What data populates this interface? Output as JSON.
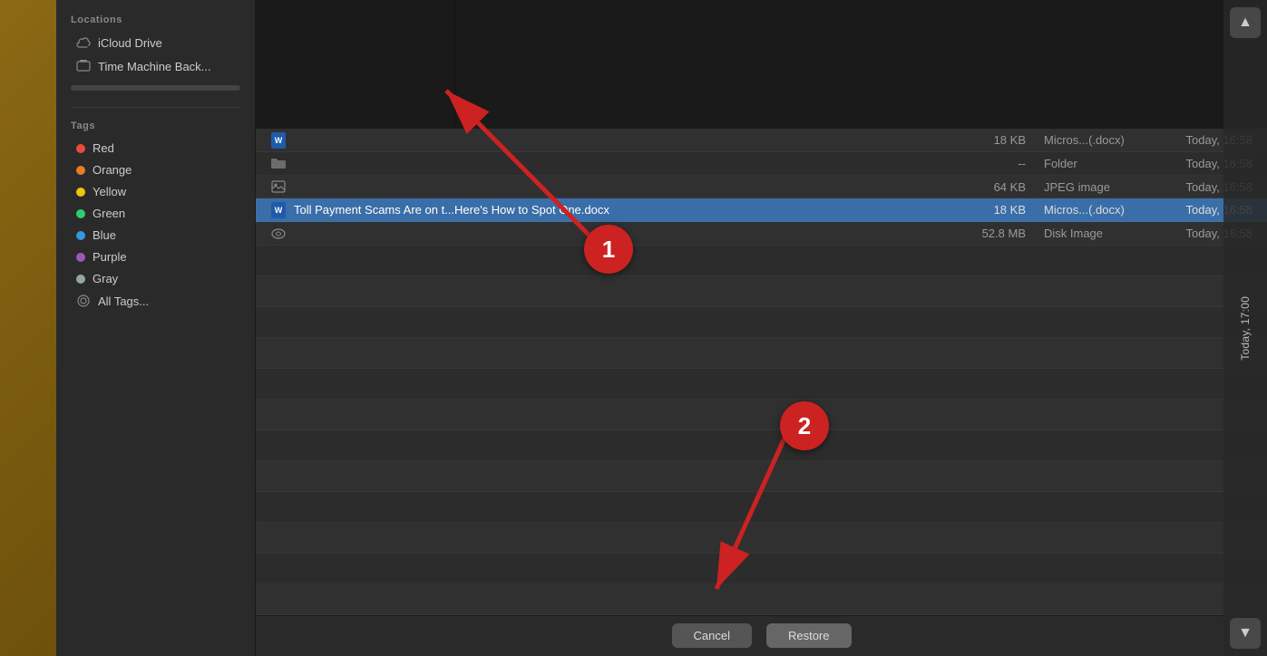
{
  "sidebar": {
    "locations_label": "Locations",
    "icloud_label": "iCloud Drive",
    "time_machine_label": "Time Machine Back...",
    "tags_label": "Tags",
    "tags": [
      {
        "name": "Red",
        "color": "#e74c3c"
      },
      {
        "name": "Orange",
        "color": "#e67e22"
      },
      {
        "name": "Yellow",
        "color": "#f1c40f"
      },
      {
        "name": "Green",
        "color": "#2ecc71"
      },
      {
        "name": "Blue",
        "color": "#3498db"
      },
      {
        "name": "Purple",
        "color": "#9b59b6"
      },
      {
        "name": "Gray",
        "color": "#95a5a6"
      }
    ],
    "all_tags_label": "All Tags..."
  },
  "file_list": {
    "rows_above": [
      {
        "size": "18 KB",
        "kind": "Micros...(.docx)",
        "date": "Today, 16:58",
        "name": "",
        "separator": true
      },
      {
        "size": "--",
        "kind": "Folder",
        "date": "Today, 16:58",
        "name": ""
      },
      {
        "size": "64 KB",
        "kind": "JPEG image",
        "date": "Today, 16:58",
        "name": ""
      }
    ],
    "selected_row": {
      "name": "Toll Payment Scams Are on t...Here's How to Spot One.docx",
      "size": "18 KB",
      "kind": "Micros...(.docx)",
      "date": "Today, 16:58"
    },
    "rows_below": [
      {
        "size": "52.8 MB",
        "kind": "Disk Image",
        "date": "Today, 16:58",
        "name": ""
      }
    ]
  },
  "timeline": {
    "up_arrow": "▲",
    "down_arrow": "▼",
    "date": "Today, 17:00"
  },
  "buttons": {
    "cancel": "Cancel",
    "restore": "Restore"
  },
  "annotations": {
    "circle1_label": "1",
    "circle2_label": "2"
  }
}
